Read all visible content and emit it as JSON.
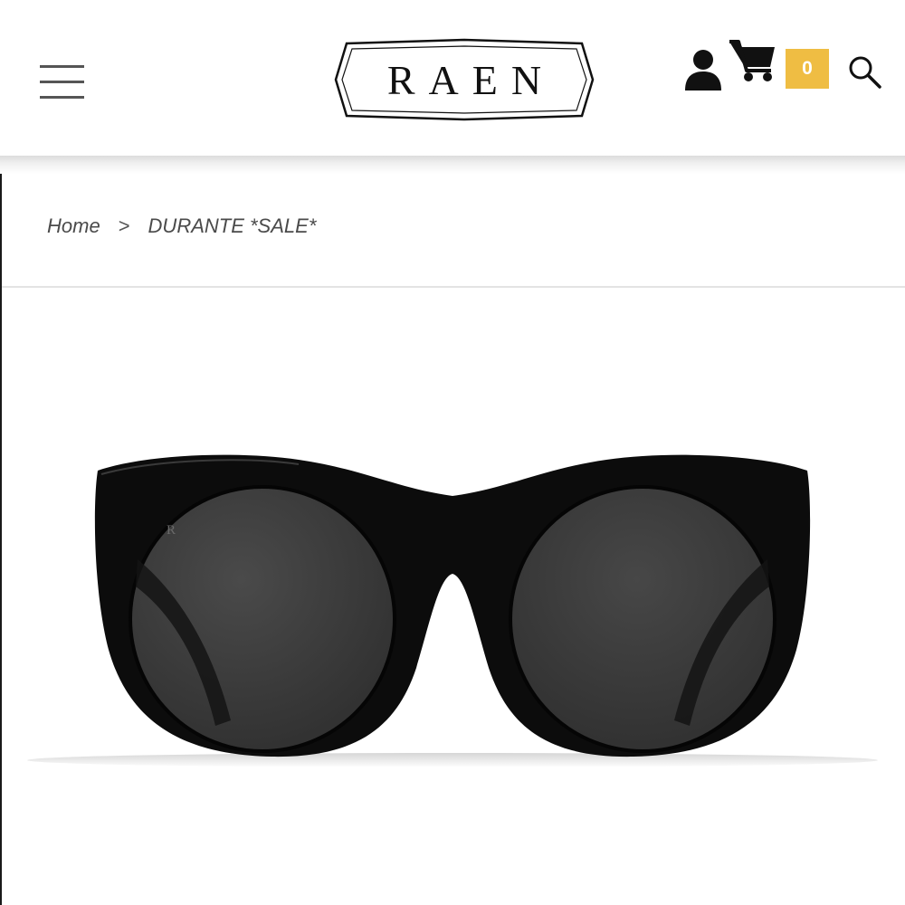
{
  "header": {
    "logo_text": "RAEN",
    "cart_count": "0",
    "icons": {
      "menu": "hamburger-menu-icon",
      "account": "user-icon",
      "cart": "shopping-cart-icon",
      "search": "search-icon"
    },
    "colors": {
      "cart_badge": "#efbd43",
      "logo": "#111111"
    }
  },
  "breadcrumb": {
    "home": "Home",
    "separator": ">",
    "current": "DURANTE *SALE*"
  },
  "product": {
    "image": "black cat-eye sunglasses with dark grey round lenses",
    "lens_mark": "R",
    "colors": {
      "frame": "#0c0c0c",
      "lens": "#3c3c3c"
    }
  }
}
